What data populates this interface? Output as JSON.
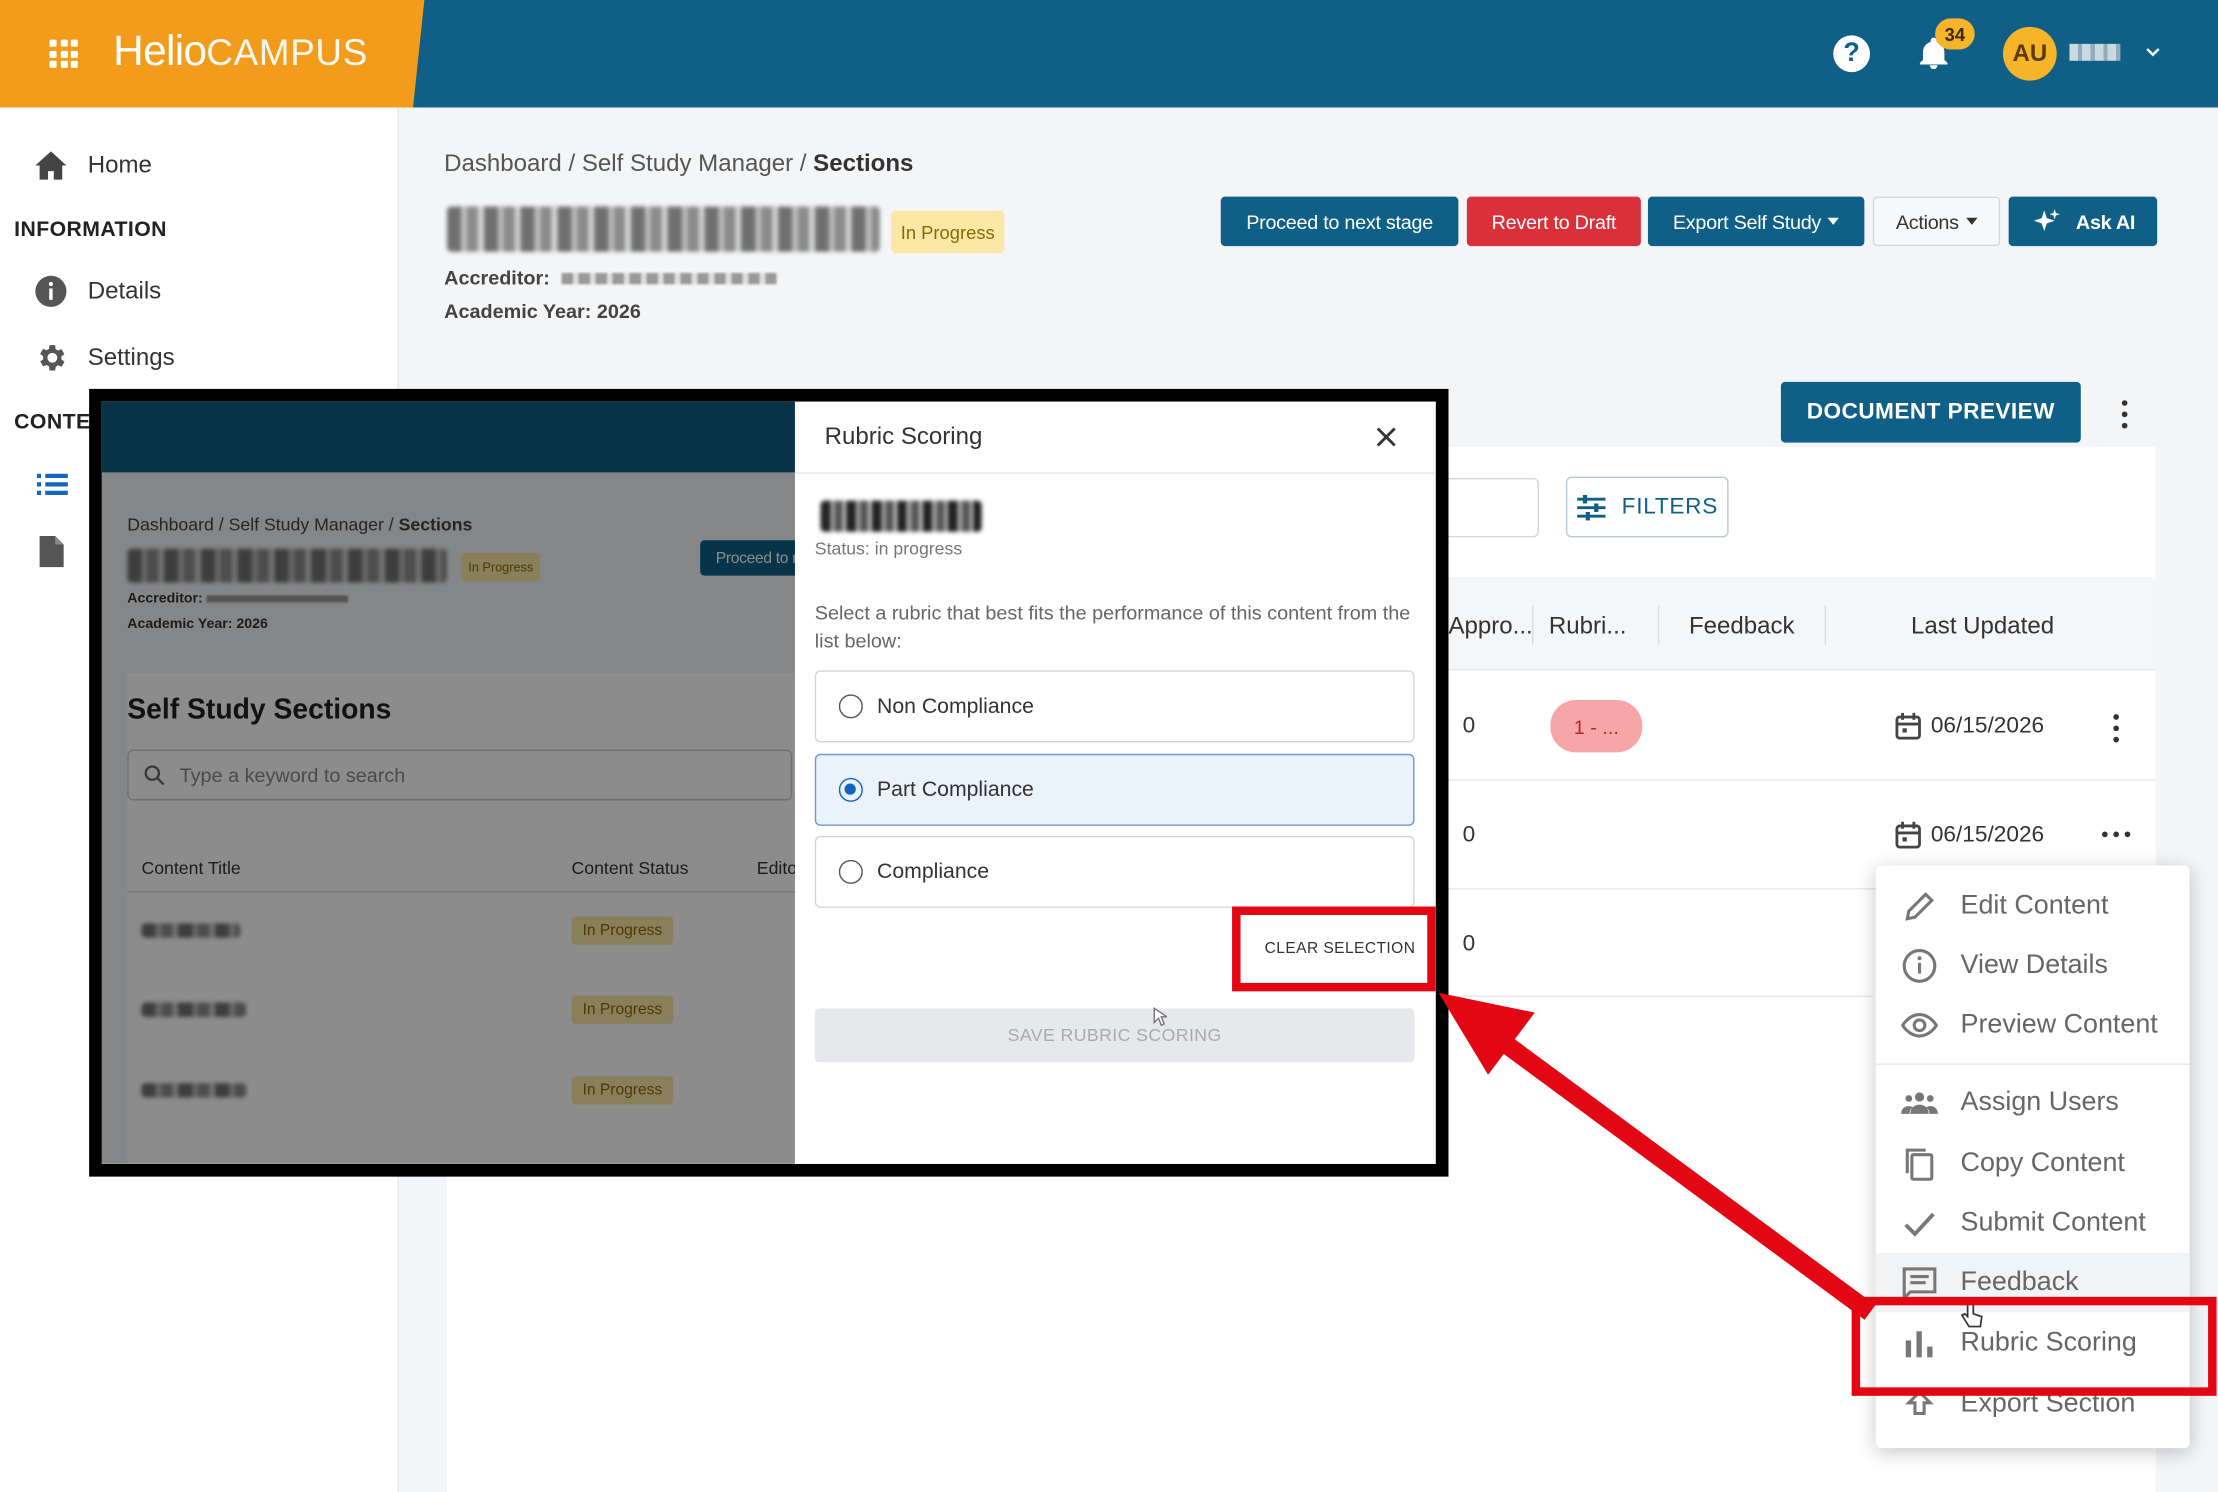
{
  "topbar": {
    "brand_main": "Helio",
    "brand_sub": "CAMPUS",
    "help_glyph": "?",
    "notifications_count": "34",
    "avatar_initials": "AU",
    "colors": {
      "bar": "#0f5f86",
      "brand": "#f39c1b",
      "badge": "#f5b42a"
    }
  },
  "sidebar": {
    "home": "Home",
    "information_header": "INFORMATION",
    "details": "Details",
    "settings": "Settings",
    "content_header": "CONTE"
  },
  "header": {
    "breadcrumb": {
      "dashboard": "Dashboard /",
      "manager": "Self Study Manager /",
      "current": "Sections"
    },
    "status": "In Progress",
    "accreditor_label": "Accreditor:",
    "academic_year": "Academic Year: 2026",
    "buttons": {
      "proceed": "Proceed to next stage",
      "revert": "Revert to Draft",
      "export": "Export Self Study",
      "actions": "Actions",
      "ask_ai": "Ask AI"
    }
  },
  "content": {
    "doc_preview": "DOCUMENT PREVIEW",
    "filters": "FILTERS",
    "columns": [
      "Appro...",
      "Rubri...",
      "Feedback",
      "Last Updated"
    ],
    "rows": [
      {
        "approvals": "0",
        "rubric": "1 - ...",
        "date": "06/15/2026"
      },
      {
        "approvals": "0",
        "rubric": "",
        "date": "06/15/2026"
      },
      {
        "approvals": "0",
        "rubric": "",
        "date": ""
      }
    ]
  },
  "menu": {
    "items": [
      "Edit Content",
      "View Details",
      "Preview Content",
      "Assign Users",
      "Copy Content",
      "Submit Content",
      "Feedback",
      "Rubric Scoring",
      "Export Section"
    ]
  },
  "inset": {
    "breadcrumb": {
      "dashboard": "Dashboard /",
      "manager": "Self Study Manager /",
      "current": "Sections"
    },
    "status": "In Progress",
    "proceed_btn": "Proceed to n",
    "accreditor_label": "Accreditor:",
    "academic_year": "Academic Year: 2026",
    "heading": "Self Study Sections",
    "search_placeholder": "Type a keyword to search",
    "columns": [
      "Content Title",
      "Content Status",
      "Edito"
    ],
    "row_statuses": [
      "In Progress",
      "In Progress",
      "In Progress"
    ]
  },
  "modal": {
    "title": "Rubric Scoring",
    "status_line": "Status: in progress",
    "instructions": "Select a rubric that best fits the performance of this content from the list below:",
    "options": [
      "Non Compliance",
      "Part Compliance",
      "Compliance"
    ],
    "selected_option": "Part Compliance",
    "clear": "CLEAR SELECTION",
    "save": "SAVE RUBRIC SCORING"
  },
  "annotation_color": "#e30613"
}
